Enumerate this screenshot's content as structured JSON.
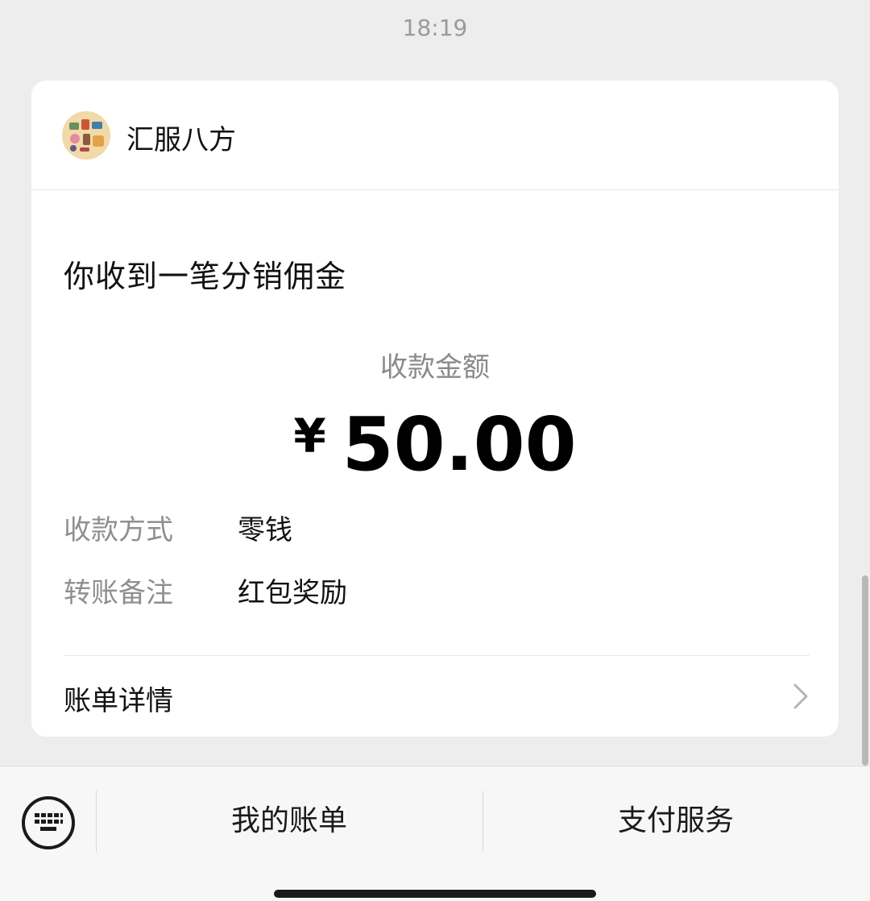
{
  "timestamp": "18:19",
  "merchant": {
    "name": "汇服八方",
    "avatar_icon": "merchant-avatar"
  },
  "notice": {
    "title": "你收到一笔分销佣金",
    "amount_label": "收款金额",
    "currency": "¥",
    "amount": "50.00"
  },
  "details": [
    {
      "key": "收款方式",
      "value": "零钱"
    },
    {
      "key": "转账备注",
      "value": "红包奖励"
    }
  ],
  "bill_link": {
    "label": "账单详情",
    "icon": "chevron-right-icon"
  },
  "bottom_menu": {
    "keyboard_icon": "keyboard-icon",
    "my_bill": "我的账单",
    "pay_service": "支付服务"
  },
  "colors": {
    "background": "#ededed",
    "card": "#ffffff",
    "muted_text": "#8f8f8f",
    "primary_text": "#111111"
  }
}
